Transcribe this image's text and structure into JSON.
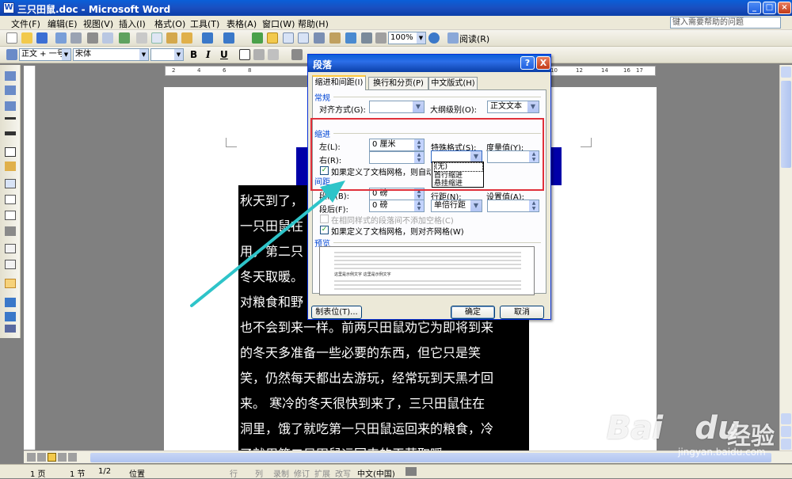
{
  "window": {
    "title": "三只田鼠.doc - Microsoft Word",
    "app_icon": "W"
  },
  "menubar": {
    "items": [
      "文件(F)",
      "编辑(E)",
      "视图(V)",
      "插入(I)",
      "格式(O)",
      "工具(T)",
      "表格(A)",
      "窗口(W)",
      "帮助(H)"
    ],
    "help_placeholder": "键入需要帮助的问题"
  },
  "standard_toolbar": {
    "zoom": "100%",
    "reading_label": "阅读(R)"
  },
  "format_toolbar": {
    "style": "正文 + 一号",
    "font": "宋体",
    "bold": "B",
    "italic": "I",
    "underline": "U"
  },
  "ruler": {
    "ticks": [
      "2",
      "4",
      "6",
      "8",
      "10",
      "12",
      "14",
      "16",
      "17"
    ]
  },
  "document": {
    "lines": [
      "秋天到了，",
      "一只田鼠在",
      "用，第二只",
      "冬天取暖。",
      "对粮食和野",
      "也不会到来一样。前两只田鼠劝它为即将到来",
      "的冬天多准备一些必要的东西，但它只是笑",
      "笑，仍然每天都出去游玩，经常玩到天黑才回",
      "来。 寒冷的冬天很快到来了，三只田鼠住在",
      "洞里，饿了就吃第一只田鼠运回来的粮食，冷",
      "了就用第二只田鼠运回来的干草取暖"
    ]
  },
  "dialog": {
    "title": "段落",
    "help_btn": "?",
    "close_btn": "X",
    "tabs": [
      "缩进和间距(I)",
      "换行和分页(P)",
      "中文版式(H)"
    ],
    "general": {
      "section": "常规",
      "alignment_label": "对齐方式(G):",
      "alignment_value": "",
      "outline_label": "大纲级别(O):",
      "outline_value": "正文文本"
    },
    "indent": {
      "section": "缩进",
      "left_label": "左(L):",
      "left_value": "0 厘米",
      "right_label": "右(R):",
      "right_value": "",
      "special_label": "特殊格式(S):",
      "special_value": "",
      "measure_label": "度量值(Y):",
      "measure_value": "",
      "grid_label": "如果定义了文档网格，则自动调整右缩进(D)",
      "special_options": [
        "(无)",
        "首行缩进",
        "悬挂缩进"
      ]
    },
    "spacing": {
      "section": "间距",
      "before_label": "段前(B):",
      "before_value": "0 磅",
      "after_label": "段后(F):",
      "after_value": "0 磅",
      "line_label": "行距(N):",
      "line_value": "单倍行距",
      "set_label": "设置值(A):",
      "set_value": "",
      "no_space_label": "在相同样式的段落间不添加空格(C)",
      "snap_label": "如果定义了文档网格，则对齐网格(W)"
    },
    "preview": {
      "section": "预览",
      "sample": "这里是示例文字 这里是示例文字"
    },
    "buttons": {
      "tabs": "制表位(T)...",
      "ok": "确定",
      "cancel": "取消"
    }
  },
  "statusbar": {
    "page": "1 页",
    "section": "1 节",
    "pages": "1/2",
    "position": "位置",
    "line": "行",
    "col": "列",
    "rec": "录制",
    "trk": "修订",
    "ext": "扩展",
    "ovr": "改写",
    "lang": "中文(中国)"
  },
  "watermark": {
    "brand": "Bai",
    "brand2": "du",
    "brand_cn": "经验",
    "url": "jingyan.baidu.com"
  },
  "colors": {
    "xp_blue": "#0a5fd8",
    "highlight_red": "#e0303a",
    "arrow": "#2ec4c9"
  }
}
